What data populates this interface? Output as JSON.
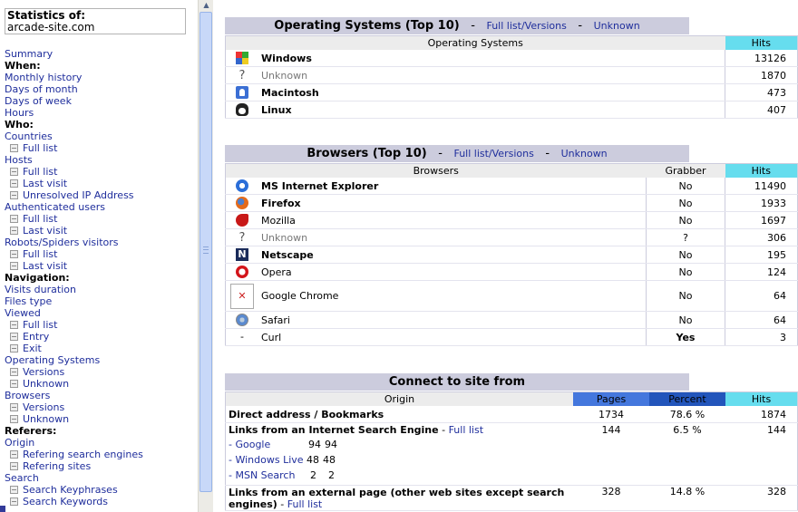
{
  "sidebar": {
    "stats_label": "Statistics of:",
    "site": "arcade-site.com",
    "items": [
      {
        "t": "Summary",
        "k": "link"
      },
      {
        "t": "When:",
        "k": "head"
      },
      {
        "t": "Monthly history",
        "k": "link"
      },
      {
        "t": "Days of month",
        "k": "link"
      },
      {
        "t": "Days of week",
        "k": "link"
      },
      {
        "t": "Hours",
        "k": "link"
      },
      {
        "t": "Who:",
        "k": "head"
      },
      {
        "t": "Countries",
        "k": "link"
      },
      {
        "t": "Full list",
        "k": "sub"
      },
      {
        "t": "Hosts",
        "k": "link"
      },
      {
        "t": "Full list",
        "k": "sub"
      },
      {
        "t": "Last visit",
        "k": "sub"
      },
      {
        "t": "Unresolved IP Address",
        "k": "sub"
      },
      {
        "t": "Authenticated users",
        "k": "link"
      },
      {
        "t": "Full list",
        "k": "sub"
      },
      {
        "t": "Last visit",
        "k": "sub"
      },
      {
        "t": "Robots/Spiders visitors",
        "k": "link"
      },
      {
        "t": "Full list",
        "k": "sub"
      },
      {
        "t": "Last visit",
        "k": "sub"
      },
      {
        "t": "Navigation:",
        "k": "head"
      },
      {
        "t": "Visits duration",
        "k": "link"
      },
      {
        "t": "Files type",
        "k": "link"
      },
      {
        "t": "Viewed",
        "k": "link"
      },
      {
        "t": "Full list",
        "k": "sub"
      },
      {
        "t": "Entry",
        "k": "sub"
      },
      {
        "t": "Exit",
        "k": "sub"
      },
      {
        "t": "Operating Systems",
        "k": "link"
      },
      {
        "t": "Versions",
        "k": "sub"
      },
      {
        "t": "Unknown",
        "k": "sub"
      },
      {
        "t": "Browsers",
        "k": "link"
      },
      {
        "t": "Versions",
        "k": "sub"
      },
      {
        "t": "Unknown",
        "k": "sub"
      },
      {
        "t": "Referers:",
        "k": "head"
      },
      {
        "t": "Origin",
        "k": "link"
      },
      {
        "t": "Refering search engines",
        "k": "sub"
      },
      {
        "t": "Refering sites",
        "k": "sub"
      },
      {
        "t": "Search",
        "k": "link"
      },
      {
        "t": "Search Keyphrases",
        "k": "sub"
      },
      {
        "t": "Search Keywords",
        "k": "sub"
      }
    ]
  },
  "os": {
    "title": "Operating Systems (Top 10)",
    "link_full": "Full list/Versions",
    "link_unknown": "Unknown",
    "dash": "-",
    "col_name": "Operating Systems",
    "col_hits": "Hits",
    "rows": [
      {
        "icon": "windows-icon",
        "name": "Windows",
        "hits": "13126",
        "bold": true
      },
      {
        "icon": "unknown-icon",
        "name": "Unknown",
        "hits": "1870",
        "bold": false,
        "grey": true
      },
      {
        "icon": "macintosh-icon",
        "name": "Macintosh",
        "hits": "473",
        "bold": true
      },
      {
        "icon": "linux-icon",
        "name": "Linux",
        "hits": "407",
        "bold": true
      }
    ]
  },
  "browsers": {
    "title": "Browsers (Top 10)",
    "link_full": "Full list/Versions",
    "link_unknown": "Unknown",
    "dash": "-",
    "col_name": "Browsers",
    "col_grabber": "Grabber",
    "col_hits": "Hits",
    "rows": [
      {
        "icon": "ie-icon",
        "name": "MS Internet Explorer",
        "grabber": "No",
        "hits": "11490",
        "bold": true
      },
      {
        "icon": "firefox-icon",
        "name": "Firefox",
        "grabber": "No",
        "hits": "1933",
        "bold": true
      },
      {
        "icon": "mozilla-icon",
        "name": "Mozilla",
        "grabber": "No",
        "hits": "1697",
        "bold": false
      },
      {
        "icon": "unknown-icon",
        "name": "Unknown",
        "grabber": "?",
        "hits": "306",
        "bold": false,
        "grey": true
      },
      {
        "icon": "netscape-icon",
        "name": "Netscape",
        "grabber": "No",
        "hits": "195",
        "bold": true
      },
      {
        "icon": "opera-icon",
        "name": "Opera",
        "grabber": "No",
        "hits": "124",
        "bold": false
      },
      {
        "icon": "chrome-broken-image-icon",
        "name": "Google Chrome",
        "grabber": "No",
        "hits": "64",
        "bold": false,
        "tall": true
      },
      {
        "icon": "safari-icon",
        "name": "Safari",
        "grabber": "No",
        "hits": "64",
        "bold": false
      },
      {
        "icon": "dash",
        "name": "Curl",
        "grabber": "Yes",
        "hits": "3",
        "bold": false,
        "grabber_bold": true
      }
    ],
    "netscape_glyph": "N",
    "unknown_glyph": "?",
    "dash_glyph": "-"
  },
  "connect": {
    "title": "Connect to site from",
    "col_origin": "Origin",
    "col_pages": "Pages",
    "col_percent": "Percent",
    "col_hits": "Hits",
    "direct": {
      "label": "Direct address / Bookmarks",
      "pages": "1734",
      "percent": "78.6 %",
      "hits": "1874"
    },
    "search": {
      "label": "Links from an Internet Search Engine",
      "sep": " - ",
      "link": "Full list",
      "pages": "144",
      "percent": "6.5 %",
      "hits": "144",
      "subs": [
        {
          "name": "- Google",
          "a": "94",
          "b": "94"
        },
        {
          "name": "- Windows Live",
          "a": "48",
          "b": "48"
        },
        {
          "name": "- MSN Search",
          "a": "2",
          "b": "2"
        }
      ]
    },
    "external": {
      "label": "Links from an external page (other web sites except search engines)",
      "sep": " - ",
      "link": "Full list",
      "pages": "328",
      "percent": "14.8 %",
      "hits": "328"
    }
  },
  "colors": {
    "title_bg": "#ccccdd",
    "hits_bg": "#66ddee",
    "pages_bg": "#4477dd",
    "percent_bg": "#2255bb",
    "link": "#1f2e9c"
  }
}
